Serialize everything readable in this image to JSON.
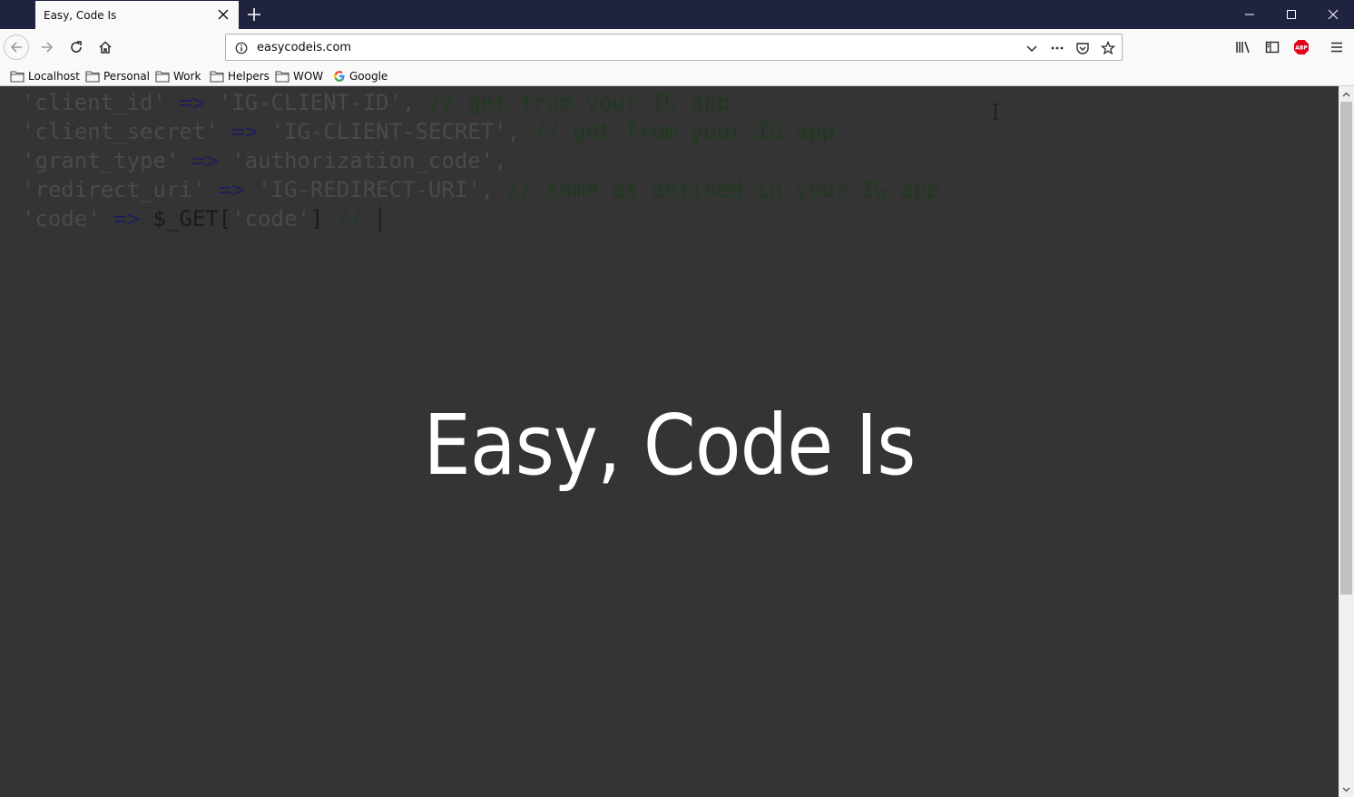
{
  "browser": {
    "tab_title": "Easy, Code Is",
    "url": "easycodeis.com",
    "bookmarks": [
      "Localhost",
      "Personal",
      "Work",
      "Helpers",
      "WOW",
      "Google"
    ],
    "abp_label": "ABP"
  },
  "code_lines": [
    [
      {
        "t": "'client_id'",
        "c": "s"
      },
      {
        "t": " => ",
        "c": "op"
      },
      {
        "t": "'IG-CLIENT-ID'",
        "c": "s"
      },
      {
        "t": ",",
        "c": "s"
      },
      {
        "t": " // get from your IG app",
        "c": "cm"
      }
    ],
    [
      {
        "t": "'client_secret'",
        "c": "s"
      },
      {
        "t": " => ",
        "c": "op"
      },
      {
        "t": "'IG-CLIENT-SECRET'",
        "c": "s"
      },
      {
        "t": ",",
        "c": "s"
      },
      {
        "t": " // get from your IG app",
        "c": "cm"
      }
    ],
    [
      {
        "t": "'grant_type'",
        "c": "s"
      },
      {
        "t": " => ",
        "c": "op"
      },
      {
        "t": "'authorization_code'",
        "c": "s"
      },
      {
        "t": ",",
        "c": "s"
      }
    ],
    [
      {
        "t": "'redirect_uri'",
        "c": "s"
      },
      {
        "t": " => ",
        "c": "op"
      },
      {
        "t": "'IG-REDIRECT-URI'",
        "c": "s"
      },
      {
        "t": ",",
        "c": "s"
      },
      {
        "t": " // same as defined in your IG app",
        "c": "cm"
      }
    ],
    [
      {
        "t": "'code'",
        "c": "s"
      },
      {
        "t": " => ",
        "c": "op"
      },
      {
        "t": "$_GET[",
        "c": "var"
      },
      {
        "t": "'code'",
        "c": "s"
      },
      {
        "t": "]",
        "c": "var"
      },
      {
        "t": " // ",
        "c": "cm"
      }
    ]
  ],
  "hero_title": "Easy, Code Is",
  "colors": {
    "page_bg": "#343434",
    "titlebar_bg": "#202340",
    "hero_text": "#ffffff",
    "abp_red": "#e3001b"
  }
}
